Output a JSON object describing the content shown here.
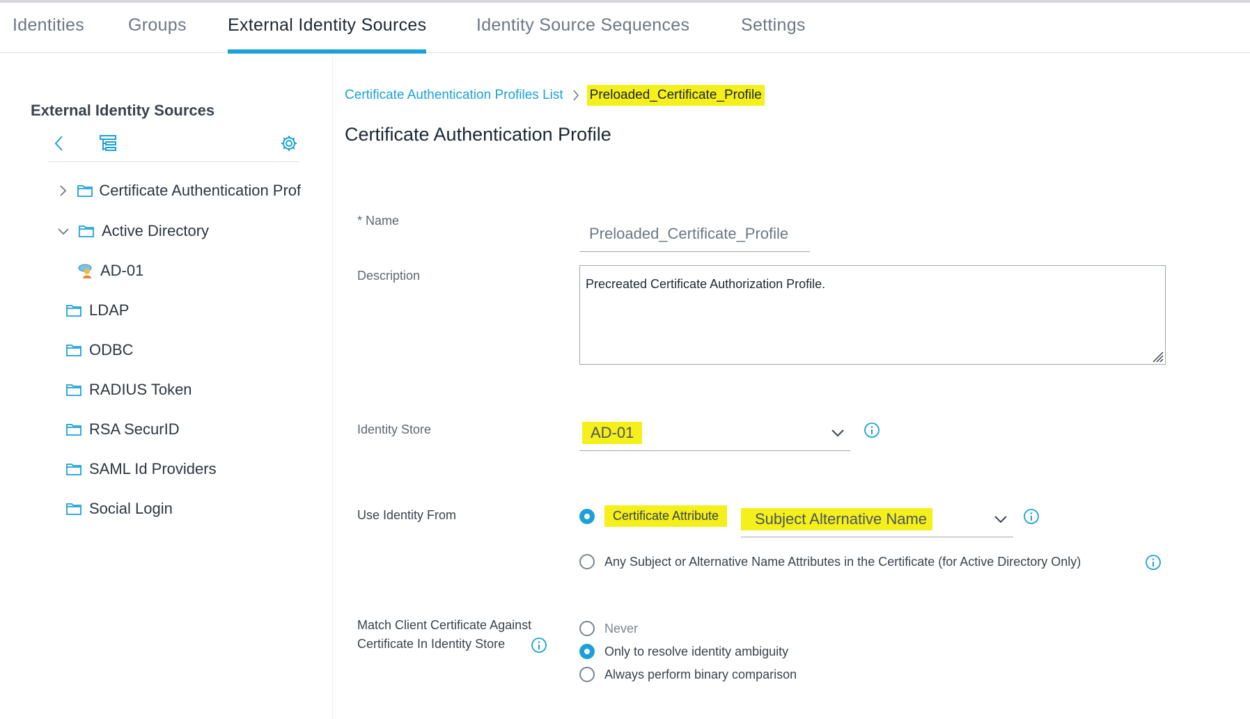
{
  "tabs": [
    {
      "label": "Identities",
      "active": false
    },
    {
      "label": "Groups",
      "active": false
    },
    {
      "label": "External Identity Sources",
      "active": true
    },
    {
      "label": "Identity Source Sequences",
      "active": false
    },
    {
      "label": "Settings",
      "active": false
    }
  ],
  "sidebar": {
    "title": "External Identity Sources",
    "toolbar": {
      "back_icon": "chevron-left-icon",
      "tree_icon": "tree-view-icon",
      "settings_icon": "gear-icon"
    },
    "items": [
      {
        "label": "Certificate Authentication Profile",
        "icon": "folder-icon",
        "expander": "collapsed"
      },
      {
        "label": "Active Directory",
        "icon": "folder-icon",
        "expander": "expanded"
      },
      {
        "label": "AD-01",
        "icon": "ad-domain-icon",
        "expander": "none"
      },
      {
        "label": "LDAP",
        "icon": "folder-icon",
        "expander": "none"
      },
      {
        "label": "ODBC",
        "icon": "folder-icon",
        "expander": "none"
      },
      {
        "label": "RADIUS Token",
        "icon": "folder-icon",
        "expander": "none"
      },
      {
        "label": "RSA SecurID",
        "icon": "folder-icon",
        "expander": "none"
      },
      {
        "label": "SAML Id Providers",
        "icon": "folder-icon",
        "expander": "none"
      },
      {
        "label": "Social Login",
        "icon": "folder-icon",
        "expander": "none"
      }
    ]
  },
  "breadcrumb": {
    "link": "Certificate Authentication Profiles List",
    "current": "Preloaded_Certificate_Profile"
  },
  "page_title": "Certificate Authentication Profile",
  "form": {
    "name": {
      "required_mark": "*",
      "label": "Name",
      "value": "Preloaded_Certificate_Profile"
    },
    "description": {
      "label": "Description",
      "value": "Precreated Certificate Authorization Profile."
    },
    "identity_store": {
      "label": "Identity Store",
      "value": "AD-01"
    },
    "use_identity_from": {
      "label": "Use Identity From",
      "option_certificate_attribute": "Certificate Attribute",
      "certificate_attribute_value": "Subject Alternative Name",
      "option_any_subject": "Any Subject or Alternative Name Attributes in the Certificate (for Active Directory Only)",
      "selected": "Certificate Attribute"
    },
    "match_client_certificate": {
      "label_line1": "Match Client Certificate Against",
      "label_line2": "Certificate In Identity Store",
      "options": [
        "Never",
        "Only to resolve identity ambiguity",
        "Always perform binary comparison"
      ],
      "selected": "Only to resolve identity ambiguity"
    }
  },
  "colors": {
    "accent": "#1ba0d7",
    "highlight": "#f5ef1b",
    "text": "#39424e"
  }
}
